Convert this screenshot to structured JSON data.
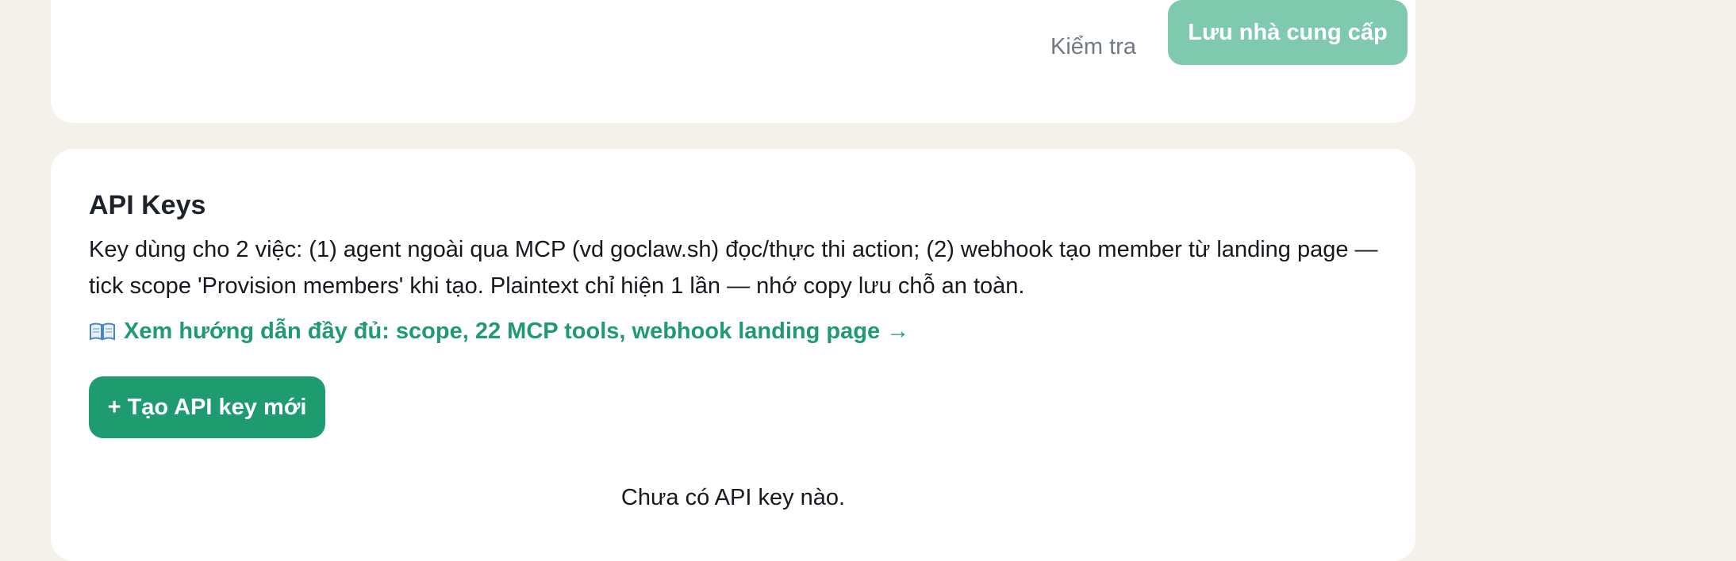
{
  "provider_form": {
    "test_button_label": "Kiểm tra",
    "save_button_label": "Lưu nhà cung cấp"
  },
  "api_keys": {
    "title": "API Keys",
    "description": "Key dùng cho 2 việc: (1) agent ngoài qua MCP (vd goclaw.sh) đọc/thực thi action; (2) webhook tạo member từ landing page — tick scope 'Provision members' khi tạo. Plaintext chỉ hiện 1 lần — nhớ copy lưu chỗ an toàn.",
    "guide_link_label": "Xem hướng dẫn đầy đủ: scope, 22 MCP tools, webhook landing page →",
    "guide_link_icon": "open-book-icon",
    "create_button_label": "+ Tạo API key mới",
    "empty_state": "Chưa có API key nào."
  },
  "colors": {
    "page_background": "#f3f1e9",
    "card_background": "#ffffff",
    "accent": "#1e9c70",
    "accent_disabled": "#7fcaae",
    "muted_text": "#707a84"
  }
}
